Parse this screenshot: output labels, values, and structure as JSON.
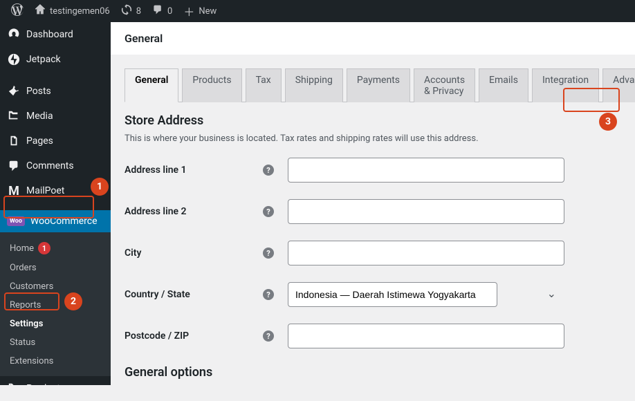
{
  "adminbar": {
    "site_name": "testingemen06",
    "updates_count": "8",
    "comments_count": "0",
    "new_label": "New"
  },
  "sidebar": {
    "items": [
      {
        "label": "Dashboard",
        "icon": "dashboard"
      },
      {
        "label": "Jetpack",
        "icon": "jetpack"
      },
      {
        "label": "Posts",
        "icon": "pin"
      },
      {
        "label": "Media",
        "icon": "media"
      },
      {
        "label": "Pages",
        "icon": "pages"
      },
      {
        "label": "Comments",
        "icon": "comments"
      },
      {
        "label": "MailPoet",
        "icon": "mailpoet"
      },
      {
        "label": "WooCommerce",
        "icon": "woo"
      },
      {
        "label": "Products",
        "icon": "products"
      }
    ],
    "woo_submenu": [
      {
        "label": "Home",
        "badge": "1"
      },
      {
        "label": "Orders"
      },
      {
        "label": "Customers"
      },
      {
        "label": "Reports"
      },
      {
        "label": "Settings",
        "current": true
      },
      {
        "label": "Status"
      },
      {
        "label": "Extensions"
      }
    ]
  },
  "page": {
    "title": "General"
  },
  "tabs": [
    {
      "label": "General",
      "active": true
    },
    {
      "label": "Products"
    },
    {
      "label": "Tax"
    },
    {
      "label": "Shipping"
    },
    {
      "label": "Payments"
    },
    {
      "label": "Accounts & Privacy"
    },
    {
      "label": "Emails"
    },
    {
      "label": "Integration"
    },
    {
      "label": "Advanced"
    }
  ],
  "store_address": {
    "heading": "Store Address",
    "description": "This is where your business is located. Tax rates and shipping rates will use this address.",
    "fields": {
      "address1_label": "Address line 1",
      "address2_label": "Address line 2",
      "city_label": "City",
      "country_label": "Country / State",
      "country_value": "Indonesia — Daerah Istimewa Yogyakarta",
      "postcode_label": "Postcode / ZIP"
    }
  },
  "general_options": {
    "heading": "General options"
  },
  "annotations": {
    "badge1": "1",
    "badge2": "2",
    "badge3": "3"
  }
}
